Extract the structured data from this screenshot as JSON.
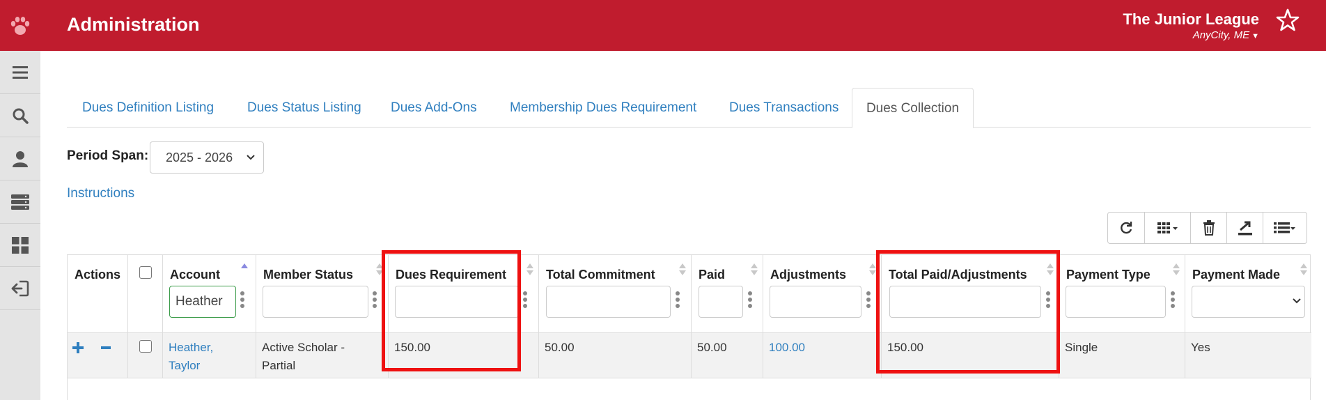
{
  "header": {
    "title": "Administration",
    "org_name": "The Junior League",
    "org_city": "AnyCity, ME"
  },
  "sidebar": {
    "items": [
      {
        "icon": "menu-icon"
      },
      {
        "icon": "search-icon"
      },
      {
        "icon": "user-icon"
      },
      {
        "icon": "server-icon"
      },
      {
        "icon": "dashboard-icon"
      },
      {
        "icon": "sign-out-icon"
      }
    ]
  },
  "tabs": [
    {
      "label": "Dues Definition Listing",
      "active": false
    },
    {
      "label": "Dues Status Listing",
      "active": false
    },
    {
      "label": "Dues Add-Ons",
      "active": false
    },
    {
      "label": "Membership Dues Requirement",
      "active": false
    },
    {
      "label": "Dues Transactions",
      "active": false
    },
    {
      "label": "Dues Collection",
      "active": true
    }
  ],
  "period": {
    "label": "Period Span:",
    "selected": "2025 - 2026"
  },
  "instructions_label": "Instructions",
  "toolbar": {
    "buttons": [
      "refresh-icon",
      "columns-icon",
      "trash-icon",
      "export-icon",
      "list-icon"
    ]
  },
  "table": {
    "columns": [
      {
        "label": "Actions"
      },
      {
        "label": ""
      },
      {
        "label": "Account",
        "filter_value": "Heather",
        "sort": "asc"
      },
      {
        "label": "Member Status",
        "filter_value": ""
      },
      {
        "label": "Dues Requirement",
        "filter_value": ""
      },
      {
        "label": "Total Commitment",
        "filter_value": ""
      },
      {
        "label": "Paid",
        "filter_value": ""
      },
      {
        "label": "Adjustments",
        "filter_value": ""
      },
      {
        "label": "Total Paid/Adjustments",
        "filter_value": ""
      },
      {
        "label": "Payment Type",
        "filter_value": ""
      },
      {
        "label": "Payment Made",
        "filter_value": ""
      }
    ],
    "rows": [
      {
        "account": "Heather, Taylor",
        "member_status": "Active Scholar - Partial",
        "dues_requirement": "150.00",
        "total_commitment": "50.00",
        "paid": "50.00",
        "adjustments": "100.00",
        "total_paid_adjustments": "150.00",
        "payment_type": "Single",
        "payment_made": "Yes"
      }
    ]
  },
  "colors": {
    "brand_red": "#c01c2e",
    "link_blue": "#2f7fbf",
    "highlight_red": "#ee1111"
  }
}
